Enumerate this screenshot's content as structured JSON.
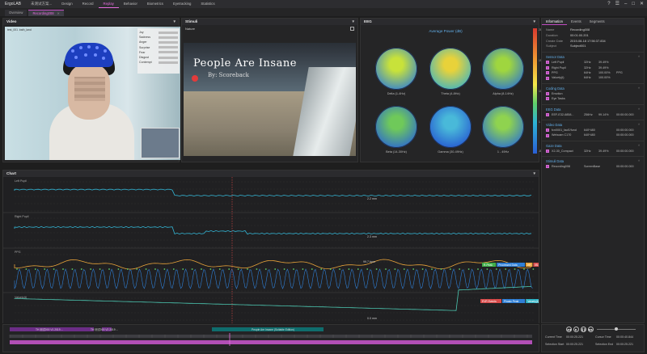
{
  "app": {
    "brand": "ErgoLAB",
    "project": "未测试方案...",
    "menu": [
      "Design",
      "Record",
      "Replay",
      "Behavior",
      "Biometrics",
      "Eyetracking",
      "Statistics"
    ],
    "active_menu": "Replay"
  },
  "subtabs": [
    {
      "label": "Overview"
    },
    {
      "label": "Recording008",
      "active": true
    }
  ],
  "video": {
    "title": "Video",
    "overlay_label": "test_001 .bath_land",
    "emotions": [
      "Joy",
      "Sadness",
      "Anger",
      "Surprise",
      "Fear",
      "Disgust",
      "Contempt"
    ]
  },
  "stimuli": {
    "title": "Stimuli",
    "label": "Nature",
    "movie_title": "People Are Insane",
    "movie_sub": "By: Scoreback"
  },
  "eeg": {
    "title": "EEG",
    "chart_title": "Average Power (dB)",
    "bands": [
      {
        "label": "Delta (1-4Hz)",
        "c1": "#c8e23a",
        "c2": "#2f7fd6"
      },
      {
        "label": "Theta (4-8Hz)",
        "c1": "#e8d23a",
        "c2": "#3ab4c6"
      },
      {
        "label": "Alpha (8-14Hz)",
        "c1": "#9fd63f",
        "c2": "#2b73d1"
      },
      {
        "label": "Beta (14-30Hz)",
        "c1": "#6fc95a",
        "c2": "#2a66d4"
      },
      {
        "label": "Gamma (30-49Hz)",
        "c1": "#49b9d9",
        "c2": "#2455d0"
      },
      {
        "label": "1 - 49Hz",
        "c1": "#8fd34f",
        "c2": "#2a6fd4"
      }
    ],
    "colorbar_ticks": [
      "28",
      "19",
      "10",
      "1",
      "-8"
    ]
  },
  "info": {
    "tabs": [
      "Information",
      "Events",
      "Segments"
    ],
    "fields": [
      {
        "k": "Name",
        "v": "Recording008"
      },
      {
        "k": "Duration",
        "v": "00:01:00.201"
      },
      {
        "k": "Create Date",
        "v": "2019-08-18 17:56:37.834"
      },
      {
        "k": "Subject",
        "v": "Subject001"
      }
    ],
    "sections": [
      {
        "title": "Sensor Data",
        "rows": [
          {
            "c1": "Left Pupil",
            "c2": "32Hz",
            "c3": "39.49%",
            "c4": ""
          },
          {
            "c1": "Right Pupil",
            "c2": "32Hz",
            "c3": "39.49%",
            "c4": ""
          },
          {
            "c1": "PPG",
            "c2": "64Hz",
            "c3": "100.00%",
            "c4": "PPG"
          },
          {
            "c1": "Valuety(t)",
            "c2": "64Hz",
            "c3": "100.00%",
            "c4": ""
          }
        ]
      },
      {
        "title": "Coding Data",
        "rows": [
          {
            "c1": "Emotion",
            "c2": "",
            "c3": "",
            "c4": ""
          },
          {
            "c1": "Eye Tasks",
            "c2": "",
            "c3": "",
            "c4": ""
          }
        ]
      },
      {
        "title": "EEG Data",
        "rows": [
          {
            "c1": "EEF-E32-6858...",
            "c2": "256Hz",
            "c3": "99.14%",
            "c4": "00:00:00.000"
          }
        ]
      },
      {
        "title": "Video Data",
        "rows": [
          {
            "c1": "fcn0001_facE/fund",
            "c2": "640*480",
            "c3": "",
            "c4": "00:00:00.000"
          },
          {
            "c1": "Webcam C170",
            "c2": "640*480",
            "c3": "",
            "c4": "00:00:00.000"
          }
        ]
      },
      {
        "title": "Gaze Data",
        "rows": [
          {
            "c1": "X2-30_Compact",
            "c2": "32Hz",
            "c3": "39.49%",
            "c4": "00:00:00.000"
          }
        ]
      },
      {
        "title": "Stimuli Data",
        "rows": [
          {
            "c1": "Recording008",
            "c2": "ScreenBase",
            "c3": "",
            "c4": "00:00:00.000"
          }
        ]
      }
    ]
  },
  "chart": {
    "title": "Chart",
    "track_labels": [
      "Left Pupil",
      "Right Pupil",
      "PPG",
      "Valuety(t)"
    ],
    "annotations": [
      "2.2 mm",
      "2.3 mm",
      "99.7 bpm",
      "0.0 mm"
    ],
    "legend_ppg": [
      "R-Peak",
      "Processed Data",
      "HR",
      "IBI"
    ],
    "legend_vel": [
      "EVR Events",
      "Phasic Peak",
      "Valuety(t)"
    ]
  },
  "timeline": {
    "segments": [
      "TH 测试000 V1 2019 ...",
      "TH 测试000 V2 2019 ...",
      "People Are Insane (Suitable Edition)"
    ]
  },
  "playback": {
    "current_time_label": "Current Time",
    "current_time": "00:00:25.221",
    "cursor_time_label": "Cursor Time",
    "cursor_time": "00:00:40.844",
    "sel_start_label": "Selection Start",
    "sel_start": "00:00:25.221",
    "sel_end_label": "Selection End",
    "sel_end": "00:00:25.221"
  }
}
